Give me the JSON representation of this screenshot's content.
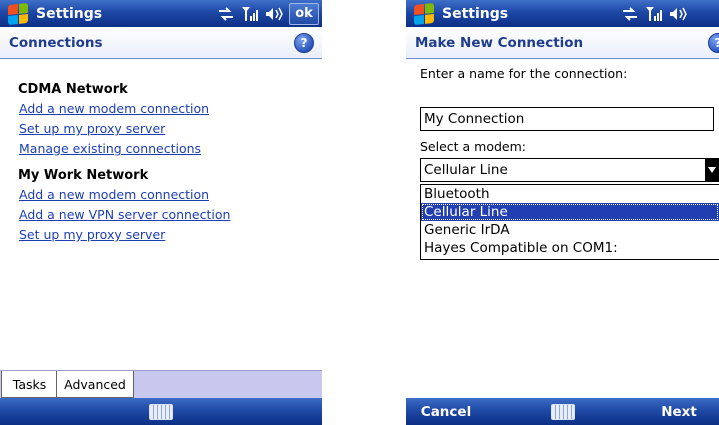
{
  "left": {
    "title": "Settings",
    "ok_label": "ok",
    "subheader": "Connections",
    "help_glyph": "?",
    "groups": [
      {
        "title": "CDMA Network",
        "links": [
          "Add a new modem connection",
          "Set up my proxy server",
          "Manage existing connections"
        ]
      },
      {
        "title": "My Work Network",
        "links": [
          "Add a new modem connection",
          "Add a new VPN server connection",
          "Set up my proxy server"
        ]
      }
    ],
    "tabs": [
      "Tasks",
      "Advanced"
    ]
  },
  "right": {
    "title": "Settings",
    "subheader": "Make New Connection",
    "help_glyph": "?",
    "name_label": "Enter a name for the connection:",
    "name_value": "My Connection",
    "modem_label": "Select a modem:",
    "modem_value": "Cellular Line",
    "modem_options": [
      "Bluetooth",
      "Cellular Line",
      "Generic IrDA",
      "Hayes Compatible on COM1:"
    ],
    "selected_option": "Cellular Line",
    "left_softkey": "Cancel",
    "right_softkey": "Next"
  },
  "colors": {
    "titlebar": "#1d48a6",
    "link": "#1d3eb4",
    "selection": "#213fb0",
    "tabbar": "#c8c8ee"
  },
  "icons": [
    "windows-start-icon",
    "connectivity-icon",
    "signal-icon",
    "speaker-icon",
    "help-icon",
    "keyboard-icon"
  ]
}
